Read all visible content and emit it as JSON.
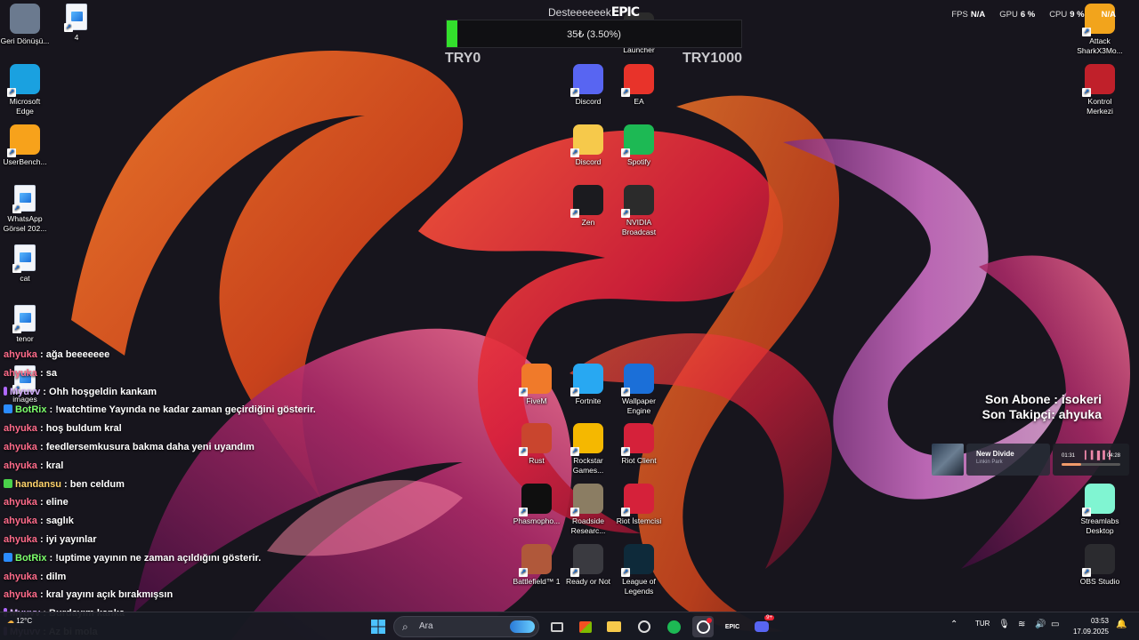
{
  "window": {
    "title": "Desktop"
  },
  "desktop_icons_left": [
    {
      "name": "desktop-icon-recycle-bin",
      "label": "Geri Dönüşü...",
      "icon": "recycle-bin-icon",
      "color": "#6b7a8f"
    },
    {
      "name": "desktop-icon-file-4",
      "label": "4",
      "icon": "image-file-icon",
      "color": "#f4f6fa"
    },
    {
      "name": "desktop-icon-edge",
      "label": "Microsoft Edge",
      "icon": "edge-icon",
      "color": "#1aa1e0"
    },
    {
      "name": "desktop-icon-userbenchmark",
      "label": "UserBench...",
      "icon": "userbenchmark-icon",
      "color": "#f7a21b"
    },
    {
      "name": "desktop-icon-whatsapp-image",
      "label": "WhatsApp Görsel 202...",
      "icon": "image-file-icon",
      "color": "#f4f6fa"
    },
    {
      "name": "desktop-icon-cat",
      "label": "cat",
      "icon": "image-file-icon",
      "color": "#f4f6fa"
    },
    {
      "name": "desktop-icon-tenor",
      "label": "tenor",
      "icon": "image-file-icon",
      "color": "#f4f6fa"
    },
    {
      "name": "desktop-icon-images",
      "label": "images",
      "icon": "image-file-icon",
      "color": "#f4f6fa"
    }
  ],
  "desktop_icons_center": [
    {
      "label": "Discord",
      "icon": "discord-icon",
      "color": "#5865f2"
    },
    {
      "label": "EA",
      "icon": "ea-icon",
      "color": "#e8332a"
    },
    {
      "label": "Discord",
      "icon": "folder-icon",
      "color": "#f6c94b"
    },
    {
      "label": "Spotify",
      "icon": "spotify-icon",
      "color": "#1db954"
    },
    {
      "label": "Zen",
      "icon": "zen-icon",
      "color": "#1b1b1f"
    },
    {
      "label": "NVIDIA Broadcast",
      "icon": "nvidia-icon",
      "color": "#2b2b2b"
    },
    {
      "label": "Launcher",
      "icon": "launcher-icon",
      "color": "#2b2b2b"
    }
  ],
  "desktop_icons_games": [
    {
      "label": "FiveM",
      "icon": "fivem-icon",
      "color": "#f07a2a"
    },
    {
      "label": "Fortnite",
      "icon": "fortnite-icon",
      "color": "#28a8f2"
    },
    {
      "label": "Wallpaper Engine",
      "icon": "wallpaper-engine-icon",
      "color": "#1b6fd8"
    },
    {
      "label": "Rust",
      "icon": "rust-icon",
      "color": "#c9452e"
    },
    {
      "label": "Rockstar Games...",
      "icon": "rockstar-icon",
      "color": "#f5b800"
    },
    {
      "label": "Riot Client",
      "icon": "riot-icon",
      "color": "#d5213a"
    },
    {
      "label": "Phasmopho...",
      "icon": "phasmophobia-icon",
      "color": "#0f0f0f"
    },
    {
      "label": "Roadside Researc...",
      "icon": "roadside-icon",
      "color": "#8b7d63"
    },
    {
      "label": "Riot İstemcisi",
      "icon": "riot-icon",
      "color": "#d5213a"
    },
    {
      "label": "Battlefield™ 1",
      "icon": "battlefield-icon",
      "color": "#b0583a"
    },
    {
      "label": "Ready or Not",
      "icon": "ready-or-not-icon",
      "color": "#3a3a40"
    },
    {
      "label": "League of Legends",
      "icon": "league-icon",
      "color": "#0e2a3a"
    }
  ],
  "desktop_icons_right": [
    {
      "label": "Attack SharkX3Mo...",
      "icon": "attack-shark-icon",
      "color": "#f2a41c"
    },
    {
      "label": "Kontrol Merkezi",
      "icon": "kontrol-merkezi-icon",
      "color": "#c0202a"
    },
    {
      "label": "Streamlabs Desktop",
      "icon": "streamlabs-icon",
      "color": "#80f5d2"
    },
    {
      "label": "OBS Studio",
      "icon": "obs-icon",
      "color": "#2b2b2f"
    }
  ],
  "donation": {
    "title_prefix": "Desteeeeeek",
    "title_brand": "EPIC",
    "amount_text": "35₺ (3.50%)",
    "progress": 0.035,
    "min_label": "TRY0",
    "max_label": "TRY1000",
    "fill_color": "#33e02c"
  },
  "perf": {
    "fps_label": "FPS",
    "fps_value": "N/A",
    "gpu_label": "GPU",
    "gpu_value": "6 %",
    "cpu_label": "CPU",
    "cpu_value": "9 %",
    "extra_value": "N/A"
  },
  "chat": [
    {
      "user": "ahyuka",
      "text": ": ağa beeeeeee",
      "color": "#ff6b8a",
      "badge": ""
    },
    {
      "user": "ahyuka",
      "text": ": sa",
      "color": "#ff6b8a",
      "badge": ""
    },
    {
      "user": "Myuvv",
      "text": ": Ohh hoşgeldin kankam",
      "color": "#d6b0ff",
      "badge": "mic"
    },
    {
      "user": "BotRix",
      "text": ": !watchtime Yayında ne kadar zaman geçirdiğini gösterir.",
      "color": "#7cff6b",
      "badge": "bot"
    },
    {
      "user": "ahyuka",
      "text": ": hoş buldum kral",
      "color": "#ff6b8a",
      "badge": ""
    },
    {
      "user": "ahyuka",
      "text": ": feedlersemkusura bakma daha yeni uyandım",
      "color": "#ff6b8a",
      "badge": ""
    },
    {
      "user": "ahyuka",
      "text": ": kral",
      "color": "#ff6b8a",
      "badge": ""
    },
    {
      "user": "handansu",
      "text": ": ben celdum",
      "color": "#ffd36b",
      "badge": "plus"
    },
    {
      "user": "ahyuka",
      "text": ": eline",
      "color": "#ff6b8a",
      "badge": ""
    },
    {
      "user": "ahyuka",
      "text": ": saglık",
      "color": "#ff6b8a",
      "badge": ""
    },
    {
      "user": "ahyuka",
      "text": ": iyi yayınlar",
      "color": "#ff6b8a",
      "badge": ""
    },
    {
      "user": "BotRix",
      "text": ": !uptime yayının ne zaman açıldığını gösterir.",
      "color": "#7cff6b",
      "badge": "bot"
    },
    {
      "user": "ahyuka",
      "text": ": dilm",
      "color": "#ff6b8a",
      "badge": ""
    },
    {
      "user": "ahyuka",
      "text": ": kral yayını açık bırakmışsın",
      "color": "#ff6b8a",
      "badge": ""
    },
    {
      "user": "Myuvv",
      "text": ": Burdayım kanka",
      "color": "#d6b0ff",
      "badge": "mic"
    },
    {
      "user": "Myuvv",
      "text": ": Az bi mola",
      "color": "#d6b0ff",
      "badge": "mic"
    }
  ],
  "stream_info": {
    "last_sub": "Son Abone : isokeri",
    "last_follower": "Son Takipçi: ahyuka"
  },
  "music": {
    "title": "New Divide",
    "artist": "Linkin Park",
    "elapsed": "01:31",
    "total": "04:28",
    "progress": 0.34
  },
  "taskbar": {
    "weather_temp": "12°C",
    "search_placeholder": "Ara",
    "language": "TUR",
    "time": "03:53",
    "date": "17.09.2025",
    "discord_badge": "9+",
    "apps": [
      "start-icon",
      "search-icon",
      "task-view-icon",
      "store-icon",
      "file-explorer-icon",
      "zen-icon",
      "spotify-icon",
      "obs-icon",
      "epic-icon",
      "discord-icon"
    ]
  }
}
